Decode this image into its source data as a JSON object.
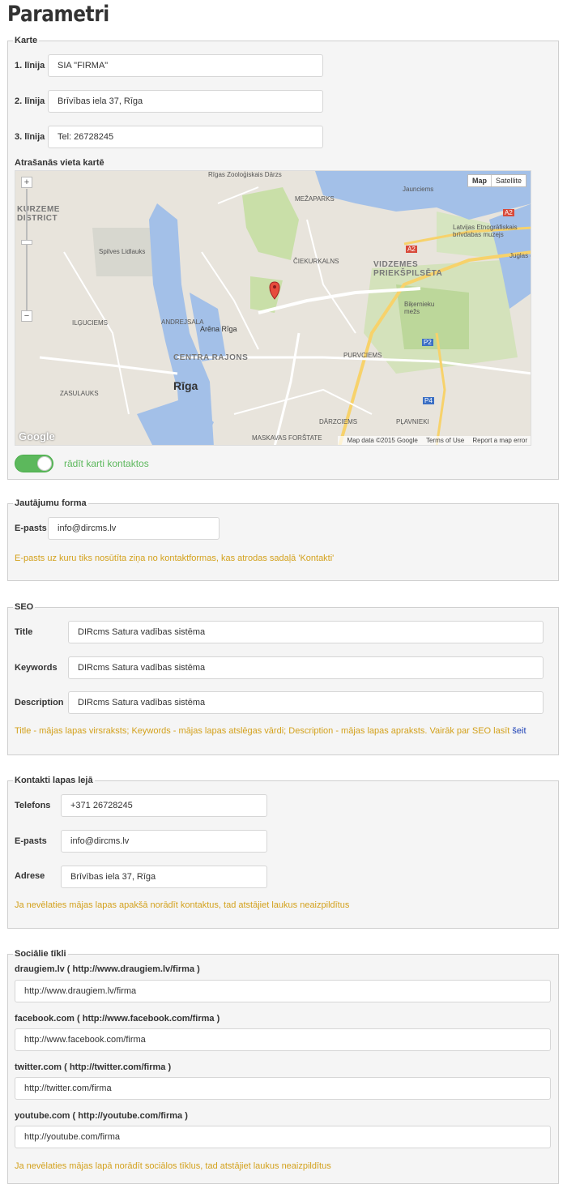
{
  "page": {
    "title": "Parametri"
  },
  "karte": {
    "legend": "Karte",
    "line1_label": "1. līnija",
    "line1_value": "SIA \"FIRMA\"",
    "line2_label": "2. līnija",
    "line2_value": "Brīvības iela 37, Rīga",
    "line3_label": "3. līnija",
    "line3_value": "Tel: 26728245",
    "map_label": "Atrašanās vieta kartē",
    "map": {
      "type_map": "Map",
      "type_satellite": "Satellite",
      "zoom_in": "+",
      "zoom_out": "−",
      "google": "Google",
      "footer_data": "Map data ©2015 Google",
      "footer_terms": "Terms of Use",
      "footer_report": "Report a map error",
      "labels": {
        "zoo": "Rīgas Zooloģiskais Dārzs",
        "jaunciems": "Jaunciems",
        "kurzeme": "KURZEME DISTRICT",
        "mezaparks": "MEŽAPARKS",
        "lidlauks": "Spilves Lidlauks",
        "vidzemes": "VIDZEMES PRIEKŠPILSĒTA",
        "etno": "Latvijas Etnogrāfiskais brīvdabas muzejs",
        "ciekurkalns": "ČIEKURKALNS",
        "andrejsala": "ANDREJSALA",
        "arena": "Arēna Rīga",
        "centra": "CENTRA RAJONS",
        "riga": "Rīga",
        "purvciems": "PURVCIEMS",
        "ilguciems": "ILĢUCIEMS",
        "zasulauks": "ZASULAUKS",
        "darzciems": "DĀRZCIEMS",
        "plavnieki": "PĻAVNIEKI",
        "maskavas": "MASKAVAS FORŠTATE",
        "bikernieku": "Biķernieku mežs",
        "juglas": "Juglas ez.",
        "a2": "A2",
        "p2": "P2",
        "p4": "P4"
      }
    },
    "toggle_label": "rādīt karti kontaktos"
  },
  "form": {
    "legend": "Jautājumu forma",
    "email_label": "E-pasts",
    "email_value": "info@dircms.lv",
    "note": "E-pasts uz kuru tiks nosūtīta ziņa no kontaktformas, kas atrodas sadaļā 'Kontakti'"
  },
  "seo": {
    "legend": "SEO",
    "title_label": "Title",
    "title_value": "DIRcms Satura vadības sistēma",
    "keywords_label": "Keywords",
    "keywords_value": "DIRcms Satura vadības sistēma",
    "description_label": "Description",
    "description_value": "DIRcms Satura vadības sistēma",
    "note": "Title - mājas lapas virsraksts; Keywords - mājas lapas atslēgas vārdi; Description - mājas lapas apraksts. Vairāk par SEO lasīt ",
    "note_link": "šeit"
  },
  "contacts": {
    "legend": "Kontakti lapas lejā",
    "phone_label": "Telefons",
    "phone_value": "+371 26728245",
    "email_label": "E-pasts",
    "email_value": "info@dircms.lv",
    "address_label": "Adrese",
    "address_value": "Brīvības iela 37, Rīga",
    "note": "Ja nevēlaties mājas lapas apakšā norādīt kontaktus, tad atstājiet laukus neaizpildītus"
  },
  "social": {
    "legend": "Sociālie tīkli",
    "draugiem_label": "draugiem.lv ( http://www.draugiem.lv/firma )",
    "draugiem_value": "http://www.draugiem.lv/firma",
    "facebook_label": "facebook.com ( http://www.facebook.com/firma )",
    "facebook_value": "http://www.facebook.com/firma",
    "twitter_label": "twitter.com ( http://twitter.com/firma )",
    "twitter_value": "http://twitter.com/firma",
    "youtube_label": "youtube.com ( http://youtube.com/firma )",
    "youtube_value": "http://youtube.com/firma",
    "note": "Ja nevēlaties mājas lapā norādīt sociālos tīklus, tad atstājiet laukus neaizpildītus"
  },
  "colors": {
    "note": "#d3a11c",
    "toggle": "#5cb85c",
    "link": "#1a3fb5",
    "box_bg": "#f5f5f5"
  }
}
